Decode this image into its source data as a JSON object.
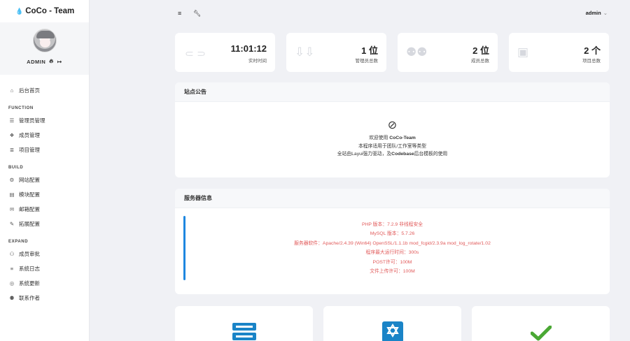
{
  "brand": {
    "name": "CoCo - Team",
    "accent": "#1a7fd6"
  },
  "profile": {
    "username": "ADMIN"
  },
  "sidebar": {
    "home": {
      "label": "后台首页",
      "icon": "home-icon"
    },
    "sections": [
      {
        "title": "FUNCTION",
        "items": [
          {
            "label": "管理员管理",
            "icon": "list-icon"
          },
          {
            "label": "成员管理",
            "icon": "puzzle-icon"
          },
          {
            "label": "项目管理",
            "icon": "layers-icon"
          }
        ]
      },
      {
        "title": "BUILD",
        "items": [
          {
            "label": "网站配置",
            "icon": "cogs-icon"
          },
          {
            "label": "模块配置",
            "icon": "grid-icon"
          },
          {
            "label": "邮箱配置",
            "icon": "envelope-icon"
          },
          {
            "label": "拓展配置",
            "icon": "paint-brush-icon"
          }
        ]
      },
      {
        "title": "EXPAND",
        "items": [
          {
            "label": "成员审批",
            "icon": "user-plus-icon"
          },
          {
            "label": "系统日志",
            "icon": "log-list-icon"
          },
          {
            "label": "系统更新",
            "icon": "globe-icon"
          },
          {
            "label": "联系作者",
            "icon": "users-icon"
          }
        ]
      }
    ]
  },
  "topbar": {
    "user": "admin"
  },
  "stats": [
    {
      "value": "11:01:12",
      "label": "实时时间",
      "icon": "sitemap-icon"
    },
    {
      "value": "1 位",
      "label": "管理员总数",
      "icon": "arrows-down-icon"
    },
    {
      "value": "2 位",
      "label": "成员总数",
      "icon": "users-icon"
    },
    {
      "value": "2 个",
      "label": "项目总数",
      "icon": "bag-icon"
    }
  ],
  "notice": {
    "title": "站点公告",
    "line1_prefix": "欢迎使用 ",
    "line1_name": "CoCo-Team",
    "line2": "本程序适用于团队/工作室等类型",
    "line3_prefix": "全站由Layui强力驱动，及",
    "line3_name": "Codebase",
    "line3_suffix": "后台模板的使用"
  },
  "server": {
    "title": "服务器信息",
    "lines": [
      "PHP 版本：7.2.9 非线程安全",
      "MySQL 版本：5.7.26",
      "服务器软件：Apache/2.4.39 (Win64) OpenSSL/1.1.1b mod_fcgid/2.3.9a mod_log_rotate/1.02",
      "程序最大运行时间：300s",
      "POST许可：100M",
      "文件上传许可：100M"
    ],
    "accent": "#1e87e0",
    "text_color": "#e15a5a"
  },
  "bottom_cards": [
    {
      "icon": "server-icon",
      "color": "#1a84c7"
    },
    {
      "icon": "star-of-david-box-icon",
      "color": "#1a84c7"
    },
    {
      "icon": "checkmark-icon",
      "color": "#4aa834"
    }
  ]
}
